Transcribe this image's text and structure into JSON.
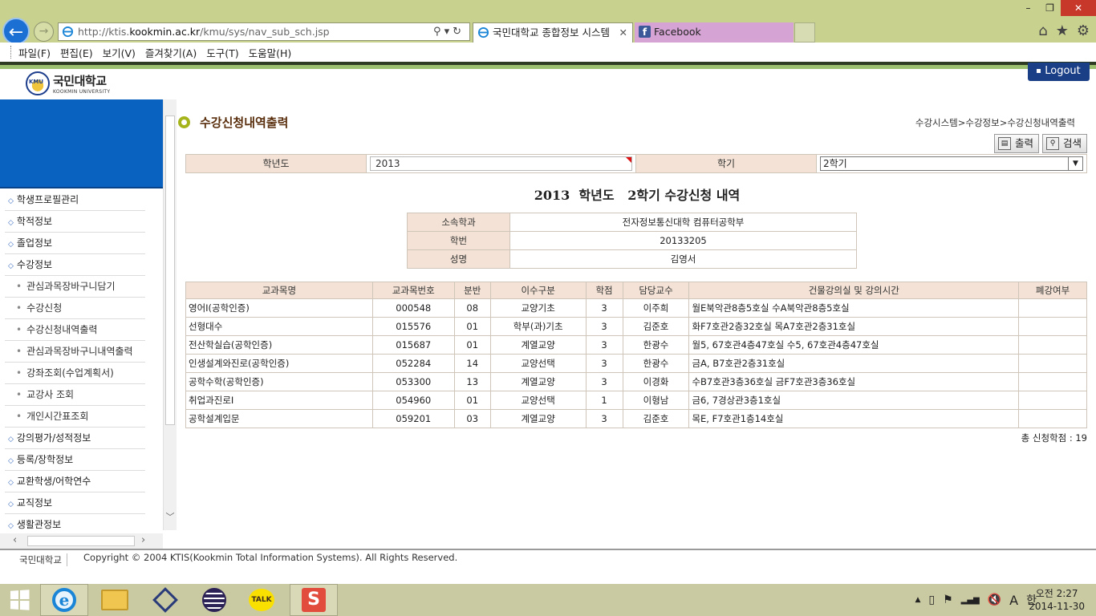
{
  "browser": {
    "url_prefix": "http://ktis.",
    "url_domain": "kookmin.ac.kr",
    "url_path": "/kmu/sys/nav_sub_sch.jsp",
    "tab_active": "국민대학교 종합정보 시스템",
    "tab_facebook": "Facebook",
    "window_controls": [
      "–",
      "❐",
      "✕"
    ],
    "right_tools": [
      "⌂",
      "★",
      "⚙"
    ],
    "menu": [
      "파일(F)",
      "편집(E)",
      "보기(V)",
      "즐겨찾기(A)",
      "도구(T)",
      "도움말(H)"
    ]
  },
  "header": {
    "logo_mark": "KMU",
    "logo_kr": "국민대학교",
    "logo_en": "KOOKMIN UNIVERSITY",
    "logout": "Logout"
  },
  "sidebar": {
    "items": [
      {
        "label": "학생프로필관리",
        "sub": false
      },
      {
        "label": "학적정보",
        "sub": false
      },
      {
        "label": "졸업정보",
        "sub": false
      },
      {
        "label": "수강정보",
        "sub": false
      },
      {
        "label": "관심과목장바구니담기",
        "sub": true
      },
      {
        "label": "수강신청",
        "sub": true
      },
      {
        "label": "수강신청내역출력",
        "sub": true
      },
      {
        "label": "관심과목장바구니내역출력",
        "sub": true
      },
      {
        "label": "강좌조회(수업계획서)",
        "sub": true
      },
      {
        "label": "교강사 조회",
        "sub": true
      },
      {
        "label": "개인시간표조회",
        "sub": true
      },
      {
        "label": "강의평가/성적정보",
        "sub": false
      },
      {
        "label": "등록/장학정보",
        "sub": false
      },
      {
        "label": "교환학생/어학연수",
        "sub": false
      },
      {
        "label": "교직정보",
        "sub": false
      },
      {
        "label": "생활관정보",
        "sub": false
      }
    ]
  },
  "main": {
    "title": "수강신청내역출력",
    "breadcrumb": "수강시스템>수강정보>수강신청내역출력",
    "print_label": "출력",
    "search_label": "검색",
    "filter": {
      "year_label": "학년도",
      "year_value": "2013",
      "term_label": "학기",
      "term_value": "2학기"
    },
    "report_heading": "2013  학년도   2학기 수강신청 내역",
    "student": {
      "dept_label": "소속학과",
      "dept_value": "전자정보통신대학 컴퓨터공학부",
      "id_label": "학번",
      "id_value": "20133205",
      "name_label": "성명",
      "name_value": "김영서"
    },
    "table": {
      "headers": [
        "교과목명",
        "교과목번호",
        "분반",
        "이수구분",
        "학점",
        "담당교수",
        "건물강의실 및 강의시간",
        "폐강여부"
      ],
      "rows": [
        [
          "영어I(공학인증)",
          "000548",
          "08",
          "교양기초",
          "3",
          "이주희",
          "월E북악관8층5호실 수A북악관8층5호실",
          ""
        ],
        [
          "선형대수",
          "015576",
          "01",
          "학부(과)기초",
          "3",
          "김준호",
          "화F7호관2층32호실 목A7호관2층31호실",
          ""
        ],
        [
          "전산학실습(공학인증)",
          "015687",
          "01",
          "계열교양",
          "3",
          "한광수",
          "월5, 67호관4층47호실 수5, 67호관4층47호실",
          ""
        ],
        [
          "인생설계와진로(공학인증)",
          "052284",
          "14",
          "교양선택",
          "3",
          "한광수",
          "금A, B7호관2층31호실",
          ""
        ],
        [
          "공학수학(공학인증)",
          "053300",
          "13",
          "계열교양",
          "3",
          "이경화",
          "수B7호관3층36호실 금F7호관3층36호실",
          ""
        ],
        [
          "취업과진로I",
          "054960",
          "01",
          "교양선택",
          "1",
          "이형남",
          "금6, 7경상관3층1호실",
          ""
        ],
        [
          "공학설계입문",
          "059201",
          "03",
          "계열교양",
          "3",
          "김준호",
          "목E, F7호관1층14호실",
          ""
        ]
      ]
    },
    "total": "총 신청학점 : 19"
  },
  "footer": {
    "name": "국민대학교",
    "copyright": "Copyright © 2004 KTIS(Kookmin Total Information Systems). All Rights Reserved."
  },
  "taskbar": {
    "ie_glyph": "e",
    "talk": "TALK",
    "s_app": "S",
    "tray": [
      "▲",
      "▯",
      "⚑",
      "▂▄▆",
      "🔇",
      "A",
      "한"
    ],
    "time": "오전 2:27",
    "date": "2014-11-30"
  },
  "colors": {
    "header_bg": "#f3e2d5",
    "title_color": "#5a2f0e",
    "banner": "#0a62c0",
    "logout_bg": "#1b3f87"
  }
}
